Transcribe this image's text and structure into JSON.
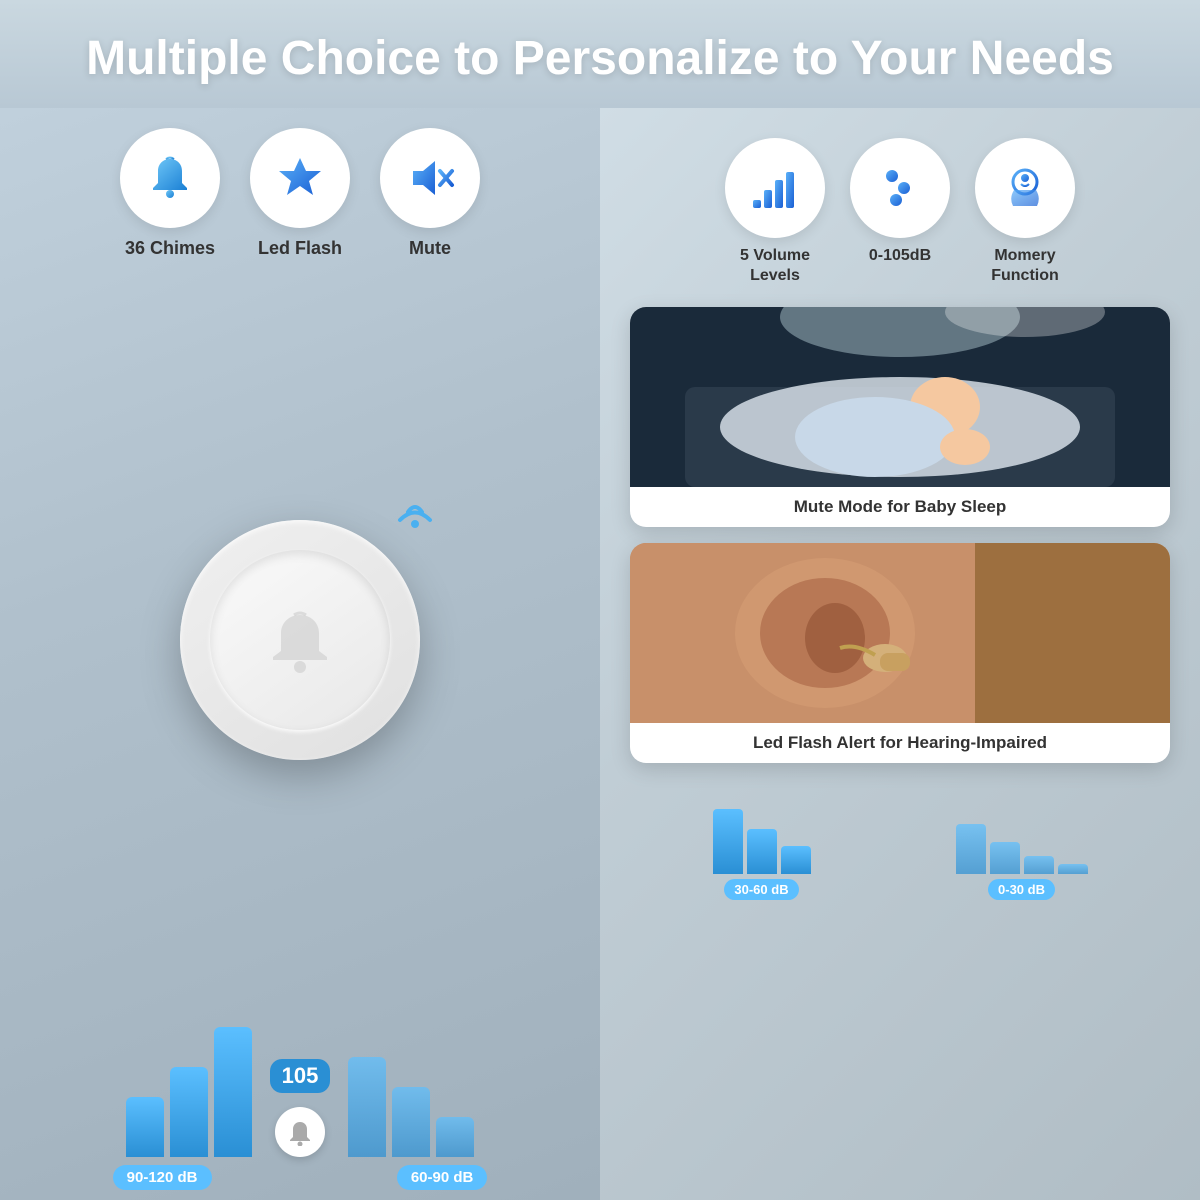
{
  "header": {
    "title": "Multiple Choice to Personalize to Your Needs"
  },
  "left_features": [
    {
      "id": "chimes",
      "label": "36 Chimes",
      "icon": "bell"
    },
    {
      "id": "led",
      "label": "Led Flash",
      "icon": "star"
    },
    {
      "id": "mute",
      "label": "Mute",
      "icon": "mute"
    }
  ],
  "right_features": [
    {
      "id": "volume",
      "label": "5 Volume\nLevels",
      "icon": "bars"
    },
    {
      "id": "db",
      "label": "0-105dB",
      "icon": "sliders"
    },
    {
      "id": "memory",
      "label": "Momery\nFunction",
      "icon": "head"
    }
  ],
  "cards": [
    {
      "id": "baby",
      "label": "Mute Mode for Baby Sleep"
    },
    {
      "id": "ear",
      "label": "Led Flash Alert for Hearing-Impaired"
    }
  ],
  "volume_indicator": "105",
  "left_bar_ranges": [
    "90-120 dB",
    "60-90 dB"
  ],
  "right_bar_ranges": [
    "30-60 dB",
    "0-30 dB"
  ],
  "colors": {
    "blue_gradient_start": "#5bbfff",
    "blue_gradient_end": "#2a8fd4",
    "header_text": "#ffffff"
  }
}
